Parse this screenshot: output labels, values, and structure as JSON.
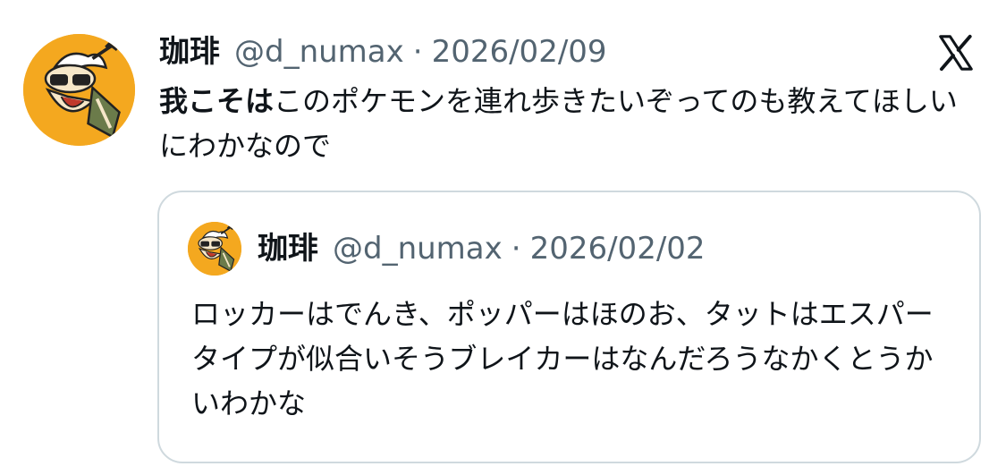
{
  "tweet": {
    "author_name": "珈琲",
    "handle": "@d_numax",
    "separator": "·",
    "date": "2026/02/09",
    "text_bold": "我こそは",
    "text_rest": "このポケモンを連れ歩きたいぞってのも教えてほしいにわかなので"
  },
  "quoted_tweet": {
    "author_name": "珈琲",
    "handle": "@d_numax",
    "separator": "·",
    "date": "2026/02/02",
    "text": "ロッカーはでんき、ポッパーはほのお、タットはエスパータイプが似合いそうブレイカーはなんだろうなかくとうかいわかな"
  },
  "icons": {
    "platform_logo": "x-logo-icon",
    "avatar": "cartoon-avatar"
  },
  "colors": {
    "text_primary": "#0f1419",
    "text_secondary": "#536471",
    "card_border": "#cfd9de",
    "avatar_bg": "#f4a81f"
  }
}
